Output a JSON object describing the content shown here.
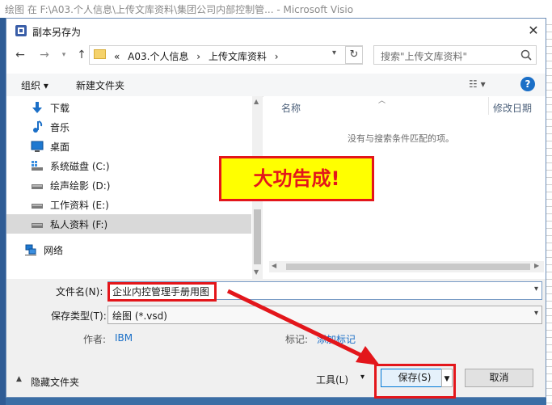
{
  "visio": {
    "window_title": "绘图 在 F:\\A03.个人信息\\上传文库资料\\集团公司内部控制管... - Microsoft Visio"
  },
  "dialog": {
    "title": "副本另存为",
    "close_glyph": "✕",
    "address": [
      "«",
      "A03.个人信息",
      "›",
      "上传文库资料",
      "›"
    ],
    "search_placeholder": "搜索\"上传文库资料\"",
    "toolbar": {
      "organize": "组织 ▾",
      "new_folder": "新建文件夹",
      "view": "☷ ▾",
      "help": "?"
    },
    "nav_items": [
      {
        "label": "下载",
        "icon": "download-icon"
      },
      {
        "label": "音乐",
        "icon": "music-icon"
      },
      {
        "label": "桌面",
        "icon": "desktop-icon"
      },
      {
        "label": "系统磁盘 (C:)",
        "icon": "system-drive-icon"
      },
      {
        "label": "绘声绘影 (D:)",
        "icon": "drive-icon"
      },
      {
        "label": "工作资料 (E:)",
        "icon": "drive-icon"
      },
      {
        "label": "私人资料 (F:)",
        "icon": "drive-icon",
        "selected": true
      },
      {
        "label": "网络",
        "icon": "network-icon"
      }
    ],
    "columns": {
      "name": "名称",
      "date": "修改日期"
    },
    "empty_message": "没有与搜索条件匹配的项。",
    "form": {
      "filename_label": "文件名(N):",
      "filename_value": "企业内控管理手册用图",
      "type_label": "保存类型(T):",
      "type_value": "绘图 (*.vsd)",
      "author_label": "作者:",
      "author_value": "IBM",
      "tags_label": "标记:",
      "tags_value": "添加标记"
    },
    "bottom": {
      "hide_folders": "隐藏文件夹",
      "tools": "工具(L)",
      "tools_arrow": "▾",
      "save": "保存(S)",
      "cancel": "取消"
    }
  },
  "annotation": {
    "callout": "大功告成!"
  },
  "colors": {
    "annotation_red": "#e3161b",
    "callout_yellow": "#ffff00",
    "accent_blue": "#1b6fc7"
  }
}
